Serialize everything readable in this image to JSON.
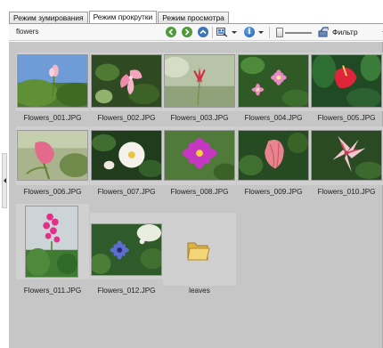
{
  "tabs": [
    {
      "label": "Режим зумирования",
      "active": false
    },
    {
      "label": "Режим прокрутки",
      "active": true
    },
    {
      "label": "Режим просмотра",
      "active": false
    }
  ],
  "toolbar": {
    "path": "flowers",
    "filter_label": "Фильтр",
    "info_label": "i",
    "icons": [
      "back-icon",
      "forward-icon",
      "up-icon",
      "view-mode-icon",
      "info-icon",
      "zoom-slider",
      "filter-icon"
    ]
  },
  "files": [
    {
      "name": "Flowers_001.JPG",
      "type": "image"
    },
    {
      "name": "Flowers_002.JPG",
      "type": "image"
    },
    {
      "name": "Flowers_003.JPG",
      "type": "image"
    },
    {
      "name": "Flowers_004.JPG",
      "type": "image"
    },
    {
      "name": "Flowers_005.JPG",
      "type": "image"
    },
    {
      "name": "Flowers_006.JPG",
      "type": "image"
    },
    {
      "name": "Flowers_007.JPG",
      "type": "image"
    },
    {
      "name": "Flowers_008.JPG",
      "type": "image"
    },
    {
      "name": "Flowers_009.JPG",
      "type": "image"
    },
    {
      "name": "Flowers_010.JPG",
      "type": "image"
    },
    {
      "name": "Flowers_011.JPG",
      "type": "image"
    },
    {
      "name": "Flowers_012.JPG",
      "type": "image"
    },
    {
      "name": "leaves",
      "type": "folder"
    }
  ],
  "colors": {
    "background": "#c6c6c6",
    "thumb_frame": "#d0d0d0",
    "toolbar": "#f7f7f7"
  }
}
